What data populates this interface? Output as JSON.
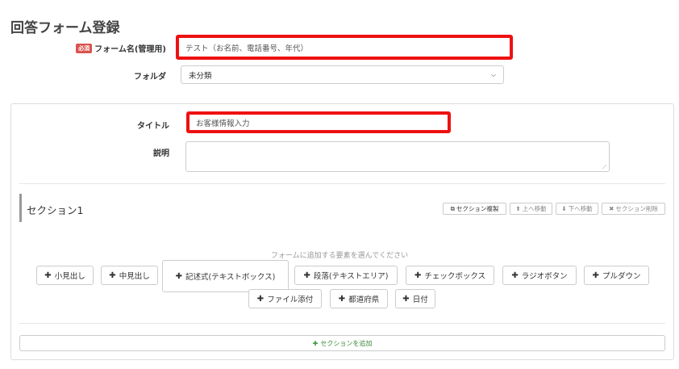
{
  "page": {
    "title": "回答フォーム登録"
  },
  "form_name": {
    "required_badge": "必須",
    "label": "フォーム名(管理用)",
    "value": "テスト（お名前、電話番号、年代）"
  },
  "folder": {
    "label": "フォルダ",
    "selected": "未分類"
  },
  "title_field": {
    "label": "タイトル",
    "value": "お客様情報入力"
  },
  "description": {
    "label": "説明",
    "value": ""
  },
  "section": {
    "title": "セクション1",
    "actions": [
      {
        "icon": "copy-icon",
        "glyph": "⧉",
        "label": "セクション複製"
      },
      {
        "icon": "arrow-up-icon",
        "glyph": "⬆",
        "label": "上へ移動"
      },
      {
        "icon": "arrow-down-icon",
        "glyph": "⬇",
        "label": "下へ移動"
      },
      {
        "icon": "close-icon",
        "glyph": "✖",
        "label": "セクション削除"
      }
    ],
    "hint": "フォームに追加する要素を選んでください",
    "element_buttons": [
      {
        "label": "小見出し"
      },
      {
        "label": "中見出し"
      },
      {
        "label": "記述式(テキストボックス)"
      },
      {
        "label": "段落(テキストエリア)"
      },
      {
        "label": "チェックボックス"
      },
      {
        "label": "ラジオボタン"
      },
      {
        "label": "プルダウン"
      },
      {
        "label": "ファイル添付"
      },
      {
        "label": "都道府県"
      },
      {
        "label": "日付"
      }
    ]
  },
  "add_section": {
    "icon": "plus-icon",
    "label": "セクションを追加"
  },
  "colors": {
    "highlight": "#ee1111",
    "required": "#d9534f",
    "add_green": "#3c8a3c"
  }
}
